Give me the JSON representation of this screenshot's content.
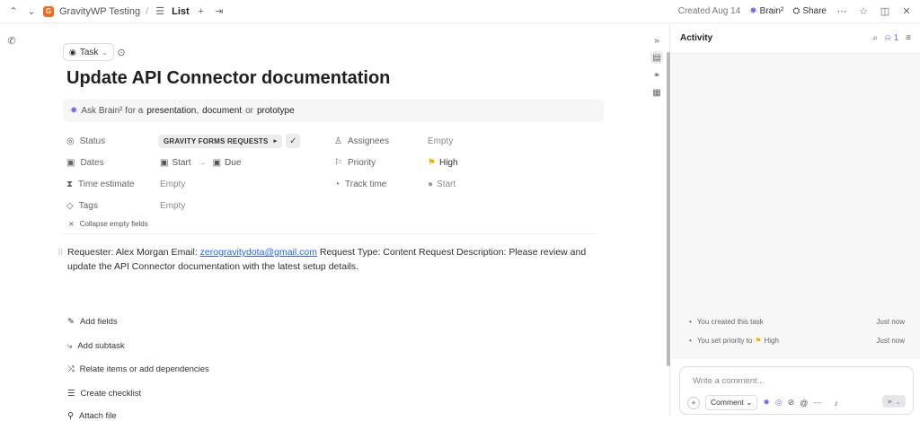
{
  "topbar": {
    "space_letter": "G",
    "space_name": "GravityWP Testing",
    "separator": "/",
    "list_label": "List",
    "created": "Created Aug 14",
    "brain": "Brain²",
    "share": "Share"
  },
  "task": {
    "type_label": "Task",
    "title": "Update API Connector documentation",
    "brain_prompt": {
      "prefix": "Ask Brain² for a",
      "opt1": "presentation",
      "sep1": ",",
      "opt2": "document",
      "sep2": "or",
      "opt3": "prototype"
    }
  },
  "fields": {
    "status_label": "Status",
    "status_value": "GRAVITY FORMS REQUESTS",
    "dates_label": "Dates",
    "start_label": "Start",
    "due_label": "Due",
    "time_estimate_label": "Time estimate",
    "time_estimate_value": "Empty",
    "tags_label": "Tags",
    "tags_value": "Empty",
    "assignees_label": "Assignees",
    "assignees_value": "Empty",
    "priority_label": "Priority",
    "priority_value": "High",
    "track_time_label": "Track time",
    "track_time_value": "Start",
    "collapse_label": "Collapse empty fields"
  },
  "description": {
    "before_link": "Requester: Alex Morgan Email: ",
    "email": "zerogravitydota@gmail.com",
    "after_link": " Request Type: Content Request  Description: Please review and update the API Connector documentation with the latest setup details."
  },
  "actions": [
    "Add fields",
    "Add subtask",
    "Relate items or add dependencies",
    "Create checklist",
    "Attach file"
  ],
  "activity": {
    "title": "Activity",
    "notif_count": "1",
    "events": [
      {
        "text": "You created this task",
        "when": "Just now"
      },
      {
        "text": "You set priority to",
        "extra": "High",
        "when": "Just now"
      }
    ],
    "comment_placeholder": "Write a comment...",
    "comment_type": "Comment"
  },
  "colors": {
    "accent": "#7b68ee",
    "space": "#f36b21",
    "priority_high": "#f8ae00",
    "link": "#2a64d6"
  }
}
